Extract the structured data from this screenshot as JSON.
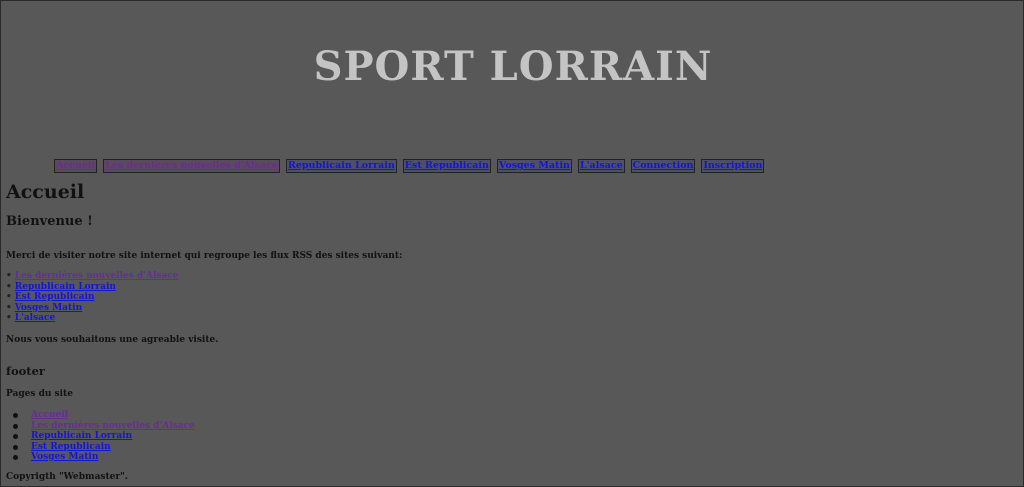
{
  "header": {
    "title": "SPORT LORRAIN"
  },
  "nav": {
    "items": [
      {
        "label": "Accueil",
        "visited": true
      },
      {
        "label": "Les dernières nouvelles d'Alsace",
        "visited": true
      },
      {
        "label": "Republicain Lorrain",
        "visited": false
      },
      {
        "label": "Est Republicain",
        "visited": false
      },
      {
        "label": "Vosges Matin",
        "visited": false
      },
      {
        "label": "L'alsace",
        "visited": false
      },
      {
        "label": "Connection",
        "visited": false
      },
      {
        "label": "Inscription",
        "visited": false
      }
    ]
  },
  "main": {
    "heading": "Accueil",
    "welcome": "Bienvenue !",
    "intro": "Merci de visiter notre site internet qui regroupe les flux RSS des sites suivant:",
    "bullet": "•",
    "feeds": [
      {
        "label": "Les dernières nouvelles d'Alsace",
        "visited": true
      },
      {
        "label": "Republicain Lorrain",
        "visited": false
      },
      {
        "label": "Est Republicain",
        "visited": false
      },
      {
        "label": "Vosges Matin",
        "visited": false
      },
      {
        "label": "L'alsace",
        "visited": false
      }
    ],
    "closing": "Nous vous souhaitons une agreable visite."
  },
  "footer": {
    "title": "footer",
    "subtitle": "Pages du site",
    "links": [
      {
        "label": "Accueil",
        "visited": true
      },
      {
        "label": "Les dernières nouvelles d'Alsace",
        "visited": true
      },
      {
        "label": "Republicain Lorrain",
        "visited": false
      },
      {
        "label": "Est Republicain",
        "visited": false
      },
      {
        "label": "Vosges Matin",
        "visited": false
      }
    ],
    "copyright": "Copyrigth \"Webmaster\"."
  },
  "colors": {
    "background": "#585858",
    "title": "#c4c4c4",
    "link": "#1414d8",
    "visited_link": "#6a2a9a"
  }
}
